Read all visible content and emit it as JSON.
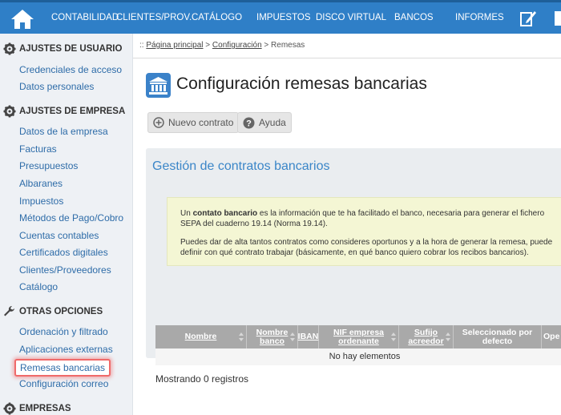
{
  "nav": {
    "items": [
      "CONTABILIDAD",
      "CLIENTES/PROV.",
      "CATÁLOGO",
      "IMPUESTOS",
      "DISCO VIRTUAL",
      "BANCOS",
      "INFORMES"
    ],
    "icons": [
      "home-icon",
      "edit-icon"
    ]
  },
  "sidebar": {
    "sections": [
      {
        "title": "AJUSTES DE USUARIO",
        "icon": "gear-icon",
        "links": [
          "Credenciales de acceso",
          "Datos personales"
        ]
      },
      {
        "title": "AJUSTES DE EMPRESA",
        "icon": "gear-icon",
        "links": [
          "Datos de la empresa",
          "Facturas",
          "Presupuestos",
          "Albaranes",
          "Impuestos",
          "Métodos de Pago/Cobro",
          "Cuentas contables",
          "Certificados digitales",
          "Clientes/Proveedores",
          "Catálogo"
        ]
      },
      {
        "title": "OTRAS OPCIONES",
        "icon": "wrench-icon",
        "links": [
          "Ordenación y filtrado",
          "Aplicaciones externas",
          "Remesas bancarias",
          "Configuración correo"
        ]
      },
      {
        "title": "EMPRESAS",
        "icon": "gear-icon",
        "links": []
      }
    ],
    "active": "Remesas bancarias"
  },
  "breadcrumb": {
    "prefix": "::",
    "home": "Página principal",
    "sep1": ">",
    "config": "Configuración",
    "sep2": ">",
    "current": "Remesas"
  },
  "page": {
    "title": "Configuración remesas bancarias",
    "icon": "bank-icon"
  },
  "toolbar": {
    "new_label": "Nuevo contrato",
    "help_label": "Ayuda"
  },
  "panel": {
    "title": "Gestión de contratos bancarios",
    "info_line1_pre": "Un ",
    "info_line1_bold": "contato bancario",
    "info_line1_post": " es la información que te ha facilitado el banco, necesaria para generar el fichero",
    "info_line2": "SEPA del cuaderno 19.14 (Norma 19.14).",
    "info_line3": "Puedes dar de alta tantos contratos como consideres oportunos y a la hora de generar la remesa, puede",
    "info_line4": "definir con qué contrato trabajar (básicamente, en qué banco quiero cobrar los recibos bancarios)."
  },
  "table": {
    "columns": [
      "Nombre",
      "Nombre banco",
      "IBAN",
      "NIF empresa ordenante",
      "Sufijo acreedor",
      "Seleccionado por defecto",
      "Ope"
    ],
    "empty_text": "No hay elementos",
    "showing": "Mostrando 0 registros"
  }
}
